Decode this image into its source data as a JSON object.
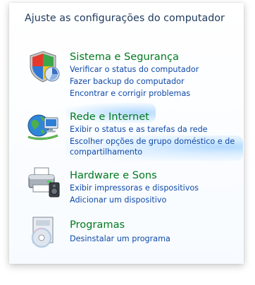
{
  "header": {
    "title": "Ajuste as configurações do computador"
  },
  "categories": [
    {
      "title": "Sistema e Segurança",
      "icon": "security-shield-icon",
      "tasks": [
        "Verificar o status do computador",
        "Fazer backup do computador",
        "Encontrar e corrigir problemas"
      ]
    },
    {
      "title": "Rede e Internet",
      "icon": "network-globe-icon",
      "tasks": [
        "Exibir o status e as tarefas da rede",
        "Escolher opções de grupo doméstico e de",
        "compartilhamento"
      ]
    },
    {
      "title": "Hardware e Sons",
      "icon": "printer-speaker-icon",
      "tasks": [
        "Exibir impressoras e dispositivos",
        "Adicionar um dispositivo"
      ]
    },
    {
      "title": "Programas",
      "icon": "programs-disc-icon",
      "tasks": [
        "Desinstalar um programa"
      ]
    }
  ],
  "colors": {
    "title": "#1e395b",
    "category_title": "#007a1f",
    "task_link": "#0f4aa8",
    "hover_glow": "#9fd0ff"
  }
}
